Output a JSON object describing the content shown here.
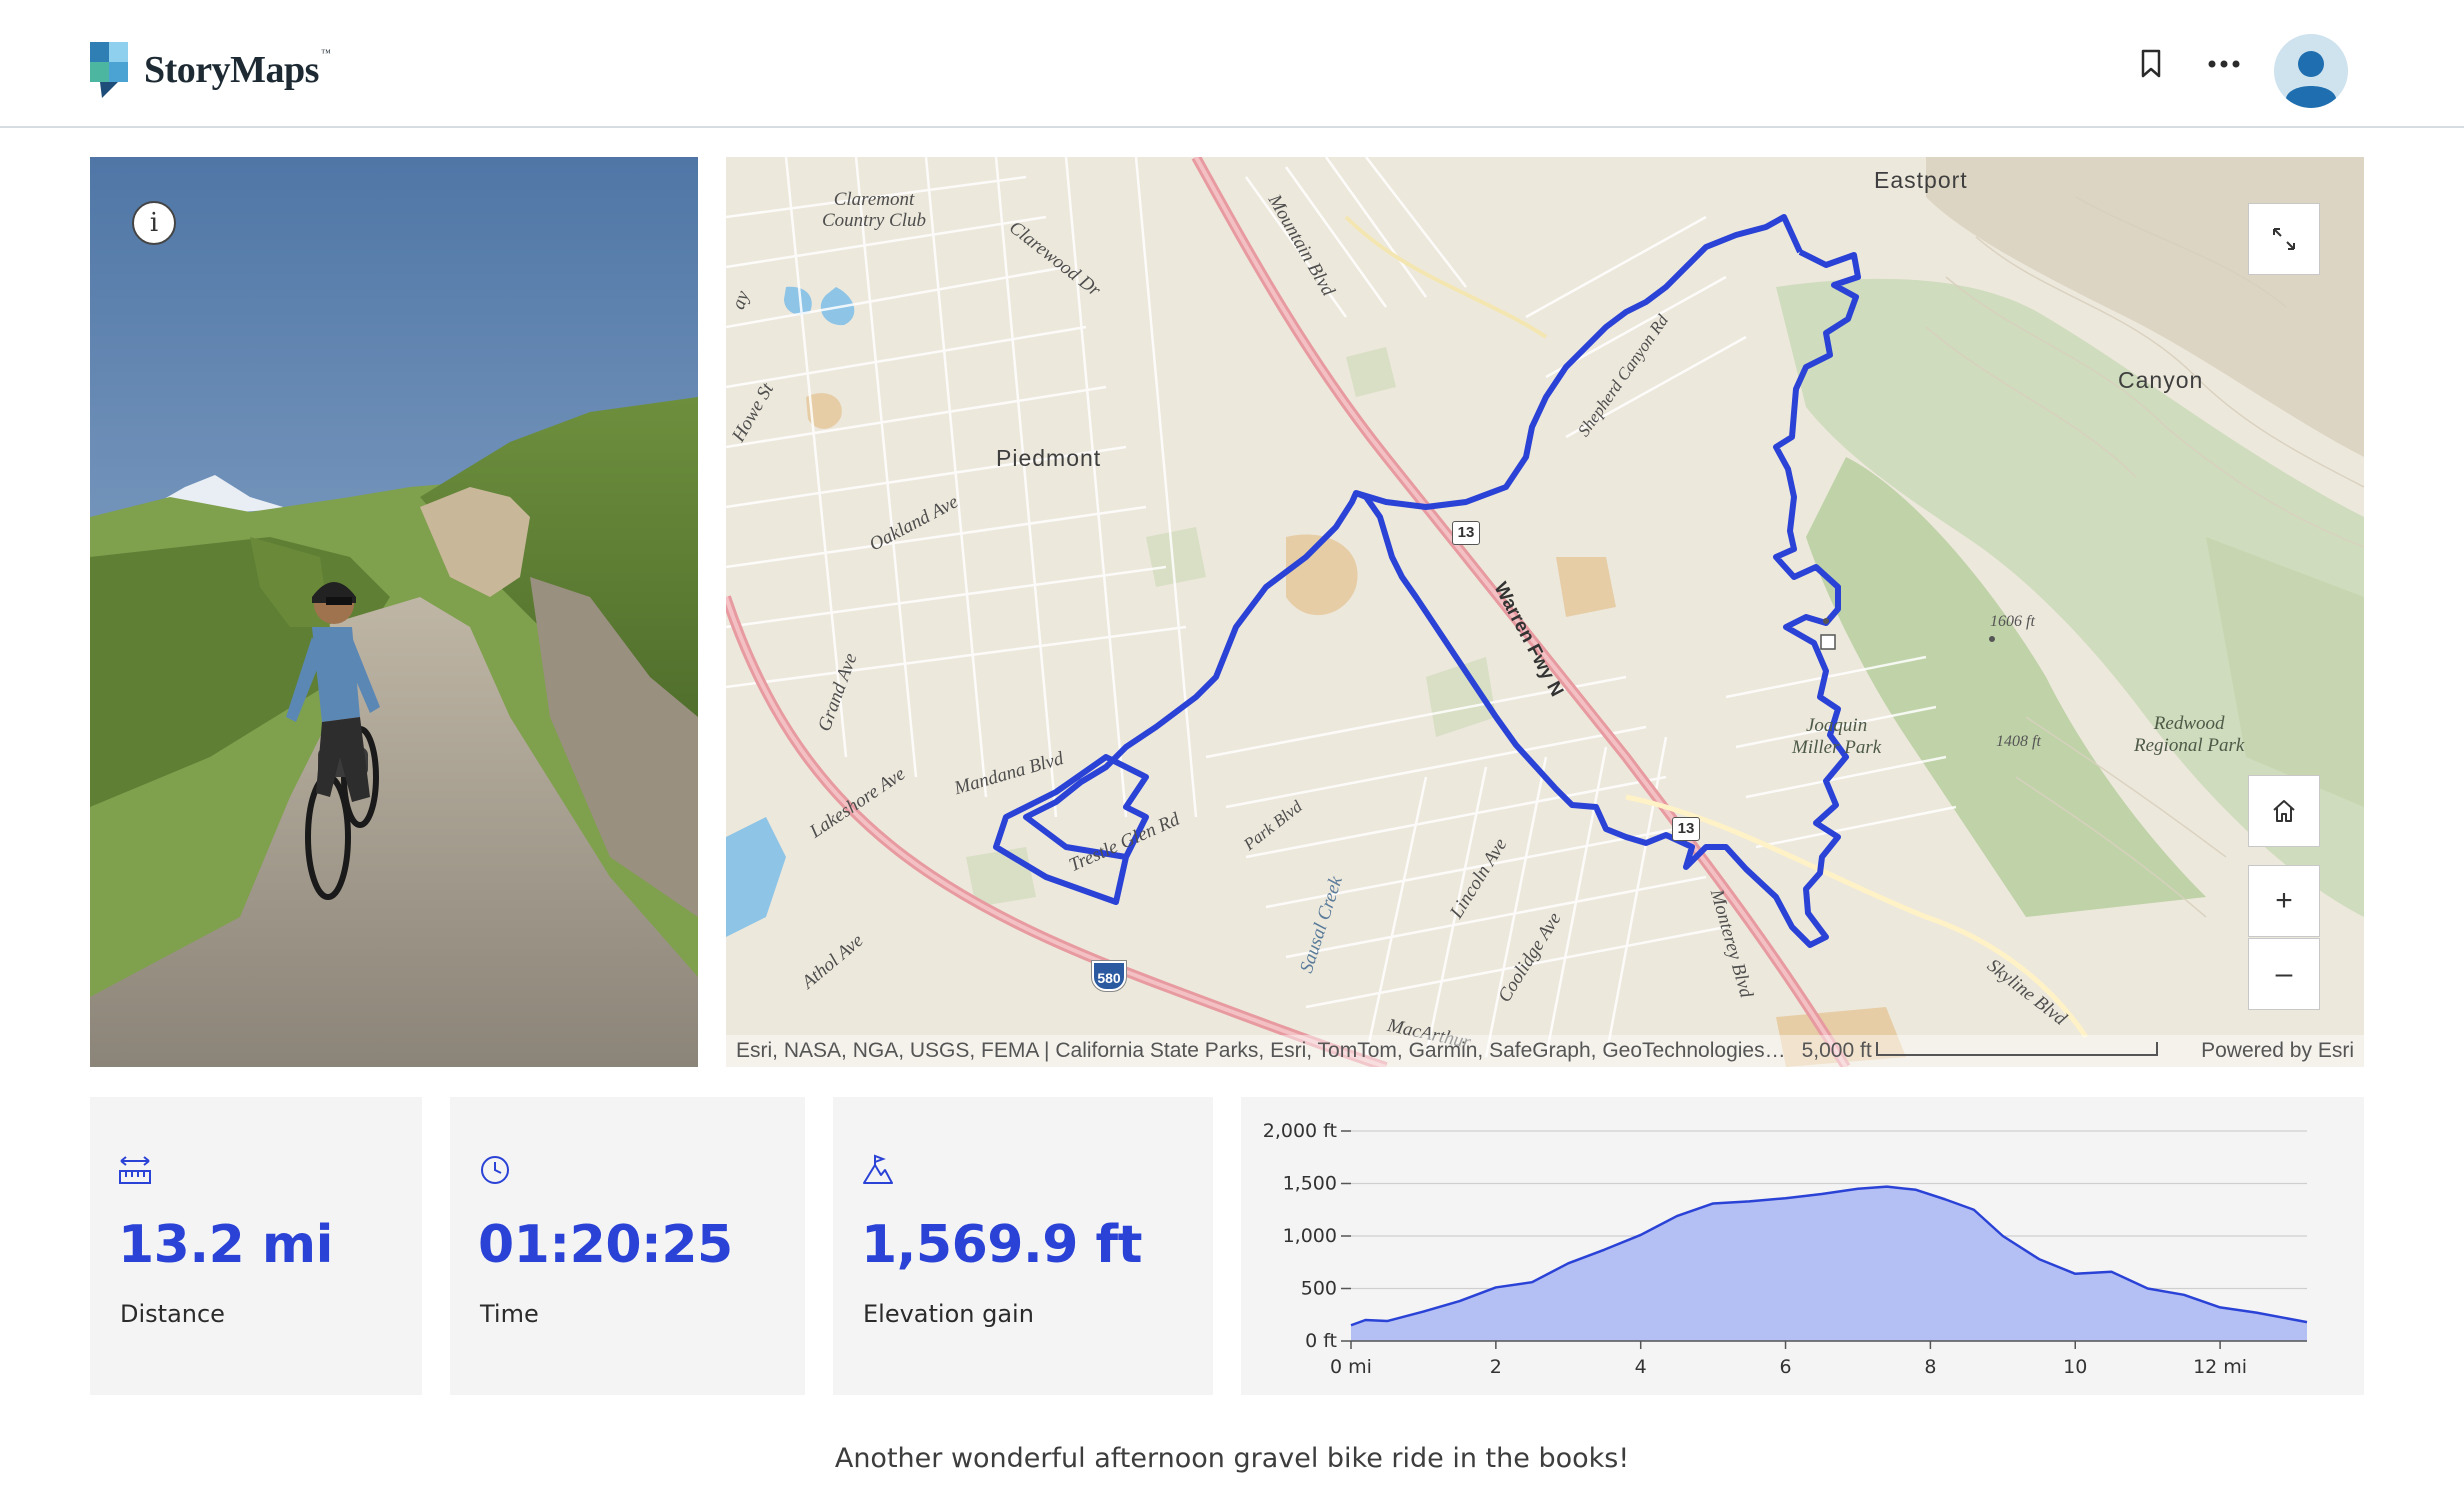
{
  "header": {
    "brand": "StoryMaps",
    "brand_mark": "™",
    "bookmark_icon": "bookmark-icon",
    "more_icon": "more-horizontal-icon",
    "avatar_icon": "user-avatar-icon"
  },
  "photo": {
    "info_label": "i"
  },
  "map": {
    "labels": {
      "claremont": "Claremont\nCountry Club",
      "clarewood": "Clarewood Dr",
      "mountain_blvd": "Mountain Blvd",
      "eastport": "Eastport",
      "canyon": "Canyon",
      "howe_st": "Howe St",
      "piedmont": "Piedmont",
      "oakland_ave": "Oakland Ave",
      "shepherd": "Shepherd Canyon Rd",
      "grand_ave": "Grand Ave",
      "warren": "Warren Fwy N",
      "peak1": "1606 ft",
      "peak2": "1408 ft",
      "joaquin": "Joaquin\nMiller Park",
      "redwood": "Redwood\nRegional Park",
      "lakeshore": "Lakeshore Ave",
      "mandana": "Mandana Blvd",
      "trestle": "Trestle Glen Rd",
      "park_blvd": "Park Blvd",
      "sausal": "Sausal Creek",
      "lincoln": "Lincoln Ave",
      "coolidge": "Coolidge Ave",
      "monterey": "Monterey Blvd",
      "skyline": "Skyline Blvd",
      "athol": "Athol Ave",
      "macarthur": "MacArthur",
      "shield_13a": "13",
      "shield_13b": "13",
      "shield_580": "580",
      "ay": "ay"
    },
    "attribution": "Esri, NASA, NGA, USGS, FEMA | California State Parks, Esri, TomTom, Garmin, SafeGraph, GeoTechnologies…",
    "scale_label": "5,000 ft",
    "powered_by": "Powered by Esri",
    "controls": {
      "expand_icon": "expand-icon",
      "home_icon": "home-icon",
      "zoom_in": "+",
      "zoom_out": "–"
    }
  },
  "stats": [
    {
      "icon": "ruler-distance-icon",
      "value": "13.2 mi",
      "label": "Distance"
    },
    {
      "icon": "clock-icon",
      "value": "01:20:25",
      "label": "Time"
    },
    {
      "icon": "mountain-flag-icon",
      "value": "1,569.9 ft",
      "label": "Elevation gain"
    }
  ],
  "chart_data": {
    "type": "area",
    "title": "",
    "xlabel": "",
    "ylabel": "",
    "x_ticks": [
      "0 mi",
      "2",
      "4",
      "6",
      "8",
      "10",
      "12 mi"
    ],
    "y_ticks": [
      "0 ft",
      "500",
      "1,000",
      "1,500",
      "2,000 ft"
    ],
    "xlim": [
      0,
      13.2
    ],
    "ylim": [
      0,
      2000
    ],
    "grid": true,
    "color": "#b4c0f4",
    "line_color": "#2a42d6",
    "x": [
      0,
      0.2,
      0.5,
      1.0,
      1.5,
      2.0,
      2.5,
      3.0,
      3.5,
      4.0,
      4.5,
      5.0,
      5.5,
      6.0,
      6.5,
      7.0,
      7.4,
      7.8,
      8.2,
      8.6,
      9.0,
      9.5,
      10.0,
      10.5,
      11.0,
      11.5,
      12.0,
      12.5,
      13.2
    ],
    "y": [
      150,
      200,
      190,
      280,
      380,
      510,
      560,
      740,
      870,
      1010,
      1190,
      1310,
      1330,
      1360,
      1400,
      1450,
      1470,
      1440,
      1350,
      1250,
      1000,
      780,
      640,
      660,
      500,
      440,
      320,
      270,
      180
    ]
  },
  "caption": "Another wonderful afternoon gravel bike ride in the books!"
}
